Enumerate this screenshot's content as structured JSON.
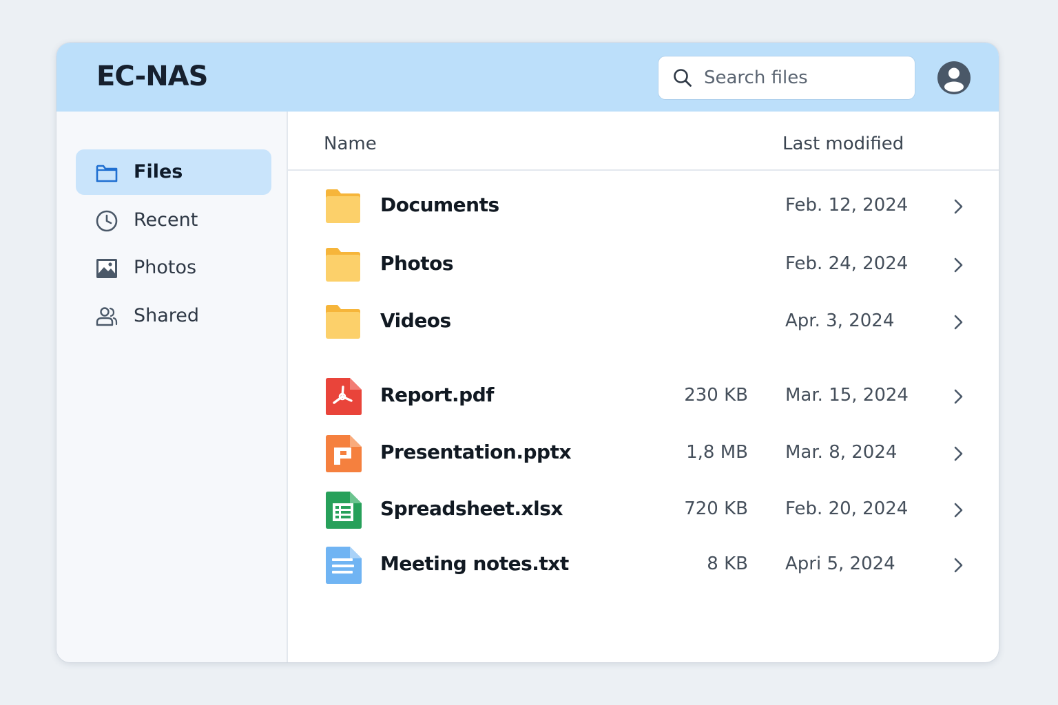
{
  "app": {
    "title": "EC-NAS"
  },
  "search": {
    "placeholder": "Search files",
    "value": ""
  },
  "user": {
    "avatar_icon": "user-circle-icon"
  },
  "sidebar": {
    "items": [
      {
        "label": "Files",
        "icon": "folder-icon",
        "active": true
      },
      {
        "label": "Recent",
        "icon": "clock-icon",
        "active": false
      },
      {
        "label": "Photos",
        "icon": "image-icon",
        "active": false
      },
      {
        "label": "Shared",
        "icon": "users-icon",
        "active": false
      }
    ]
  },
  "table": {
    "columns": {
      "name": "Name",
      "modified": "Last modified"
    },
    "rows": [
      {
        "name": "Documents",
        "size": "",
        "modified": "Feb. 12, 2024",
        "icon": "folder-icon"
      },
      {
        "name": "Photos",
        "size": "",
        "modified": "Feb. 24, 2024",
        "icon": "folder-icon"
      },
      {
        "name": "Videos",
        "size": "",
        "modified": "Apr. 3, 2024",
        "icon": "folder-icon"
      },
      {
        "name": "Report.pdf",
        "size": "230 KB",
        "modified": "Mar. 15, 2024",
        "icon": "pdf-file-icon"
      },
      {
        "name": "Presentation.pptx",
        "size": "1,8 MB",
        "modified": "Mar. 8, 2024",
        "icon": "presentation-file-icon"
      },
      {
        "name": "Spreadsheet.xlsx",
        "size": "720 KB",
        "modified": "Feb. 20, 2024",
        "icon": "spreadsheet-file-icon"
      },
      {
        "name": "Meeting notes.txt",
        "size": "8 KB",
        "modified": "Apri 5, 2024",
        "icon": "text-file-icon"
      }
    ]
  },
  "colors": {
    "header_bg": "#bcdffa",
    "active_nav_bg": "#c9e4fb",
    "accent": "#1f6fd1",
    "folder": "#fcd06a",
    "pdf": "#e9443a",
    "pptx": "#f5803e",
    "xlsx": "#27a05a",
    "txt": "#70b4f3"
  }
}
